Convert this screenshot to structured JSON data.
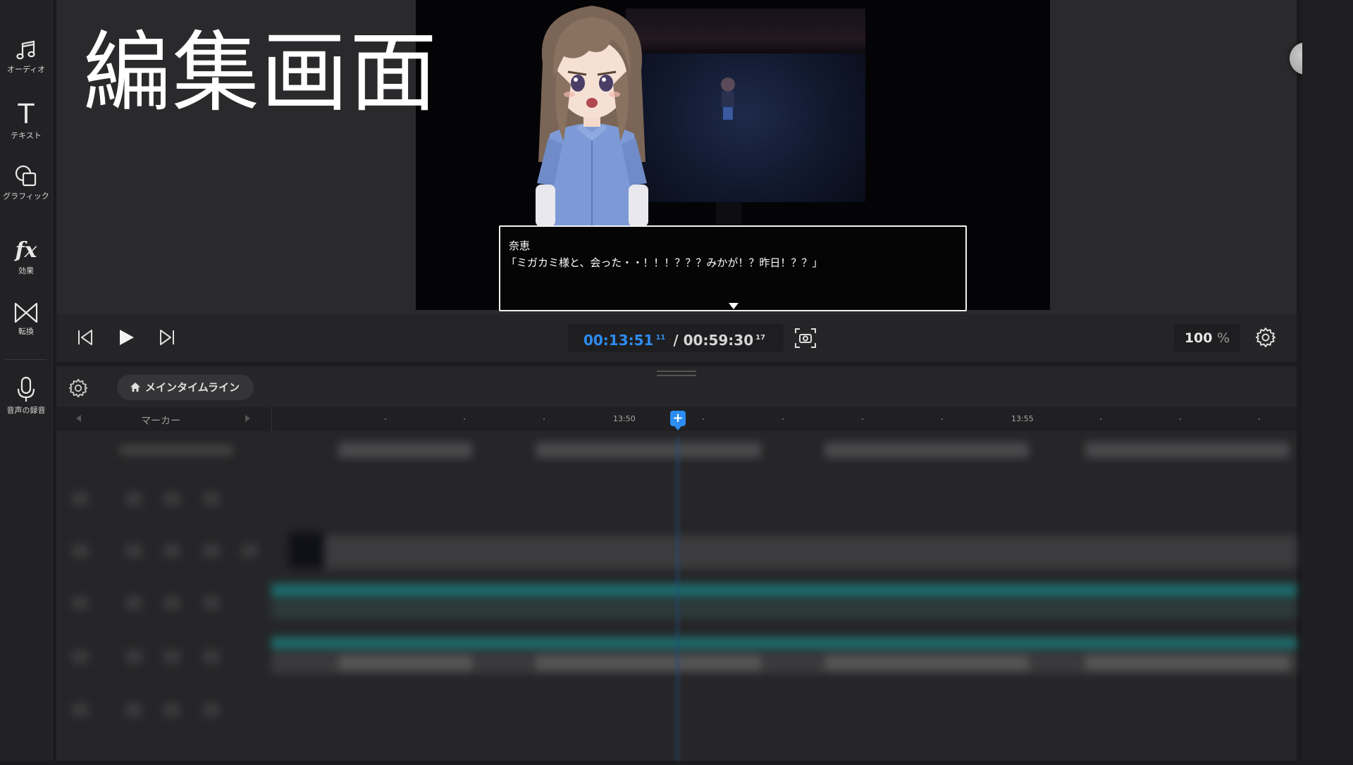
{
  "sidebar": {
    "items": [
      {
        "id": "audio",
        "label": "オーディオ",
        "icon": "music-note-icon"
      },
      {
        "id": "text",
        "label": "テキスト",
        "icon": "text-t-icon",
        "glyph": "T"
      },
      {
        "id": "graphics",
        "label": "グラフィック",
        "icon": "shapes-icon"
      },
      {
        "id": "effects",
        "label": "効果",
        "icon": "fx-icon",
        "glyph": "fx"
      },
      {
        "id": "transition",
        "label": "転換",
        "icon": "transition-bowtie-icon"
      },
      {
        "id": "voice",
        "label": "音声の録音",
        "icon": "microphone-icon"
      }
    ]
  },
  "overlay": {
    "title": "編集画面"
  },
  "preview": {
    "dialog": {
      "speaker": "奈恵",
      "line": "「ミガカミ様と、会った・・！！！？？？みかが！？昨日！？？」"
    }
  },
  "transport": {
    "current_time": "00:13:51",
    "current_frames": "11",
    "separator": "/",
    "total_time": "00:59:30",
    "total_frames": "17",
    "zoom_value": "100",
    "zoom_unit": "%"
  },
  "timeline": {
    "breadcrumb": "メインタイムライン",
    "marker_label": "マーカー",
    "ruler_labels": [
      "13:50",
      "13:55"
    ],
    "playhead_symbol": "+"
  },
  "colors": {
    "accent": "#2b8cf2",
    "panel": "#2a2a2c",
    "sidebar": "#222224",
    "clip_teal": "#1e6a6a"
  }
}
